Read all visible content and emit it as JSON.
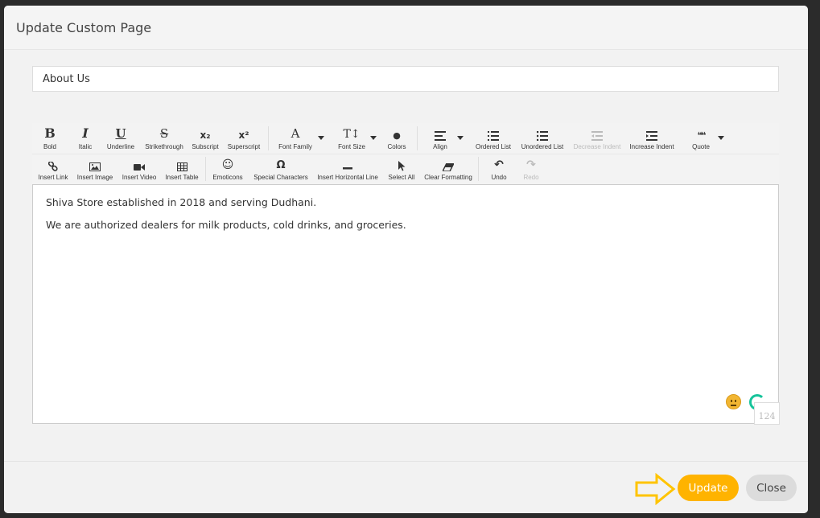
{
  "modal": {
    "title": "Update Custom Page"
  },
  "form": {
    "page_title_value": "About Us"
  },
  "toolbar": {
    "row1": {
      "bold": "Bold",
      "italic": "Italic",
      "underline": "Underline",
      "strikethrough": "Strikethrough",
      "subscript": "Subscript",
      "superscript": "Superscript",
      "font_family": "Font Family",
      "font_size": "Font Size",
      "colors": "Colors",
      "align": "Align",
      "ordered_list": "Ordered List",
      "unordered_list": "Unordered List",
      "decrease_indent": "Decrease Indent",
      "increase_indent": "Increase Indent",
      "quote": "Quote"
    },
    "row2": {
      "insert_link": "Insert Link",
      "insert_image": "Insert Image",
      "insert_video": "Insert Video",
      "insert_table": "Insert Table",
      "emoticons": "Emoticons",
      "special_characters": "Special Characters",
      "insert_hr": "Insert Horizontal Line",
      "select_all": "Select All",
      "clear_formatting": "Clear Formatting",
      "undo": "Undo",
      "redo": "Redo"
    },
    "glyphs": {
      "bold": "B",
      "italic": "I",
      "underline": "U",
      "strikethrough": "S",
      "subscript": "x₂",
      "superscript": "x²",
      "font_family": "A",
      "font_size": "T↕",
      "colors": "●",
      "quote": "❝❝",
      "emoticons": "☺",
      "special_characters": "Ω",
      "undo": "↶",
      "redo": "↷"
    }
  },
  "editor": {
    "paragraphs": [
      "Shiva Store established in 2018 and serving Dudhani.",
      "We are authorized dealers for milk products, cold drinks, and groceries."
    ],
    "char_count": "124"
  },
  "footer": {
    "update_label": "Update",
    "close_label": "Close"
  },
  "colors": {
    "accent": "#ffb300",
    "grammarly": "#15c39a"
  }
}
